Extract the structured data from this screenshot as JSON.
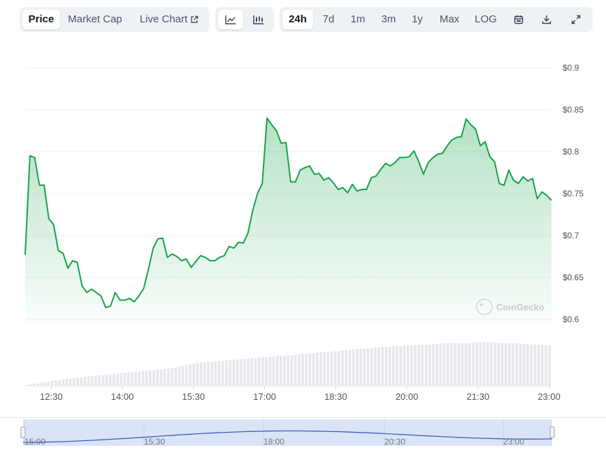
{
  "toolbar": {
    "metric_tabs": [
      {
        "label": "Price",
        "active": true
      },
      {
        "label": "Market Cap",
        "active": false
      },
      {
        "label": "Live Chart",
        "active": false
      }
    ],
    "chart_type_icons": [
      "line-chart-icon",
      "candlestick-chart-icon"
    ],
    "range_tabs": [
      {
        "label": "24h",
        "active": true
      },
      {
        "label": "7d",
        "active": false
      },
      {
        "label": "1m",
        "active": false
      },
      {
        "label": "3m",
        "active": false
      },
      {
        "label": "1y",
        "active": false
      },
      {
        "label": "Max",
        "active": false
      },
      {
        "label": "LOG",
        "active": false
      }
    ],
    "action_icons": [
      "calendar-icon",
      "download-icon",
      "expand-icon"
    ]
  },
  "watermark": {
    "text": "CoinGecko",
    "icon": "coingecko-logo-icon"
  },
  "colors": {
    "line": "#16a34a",
    "fill_top": "#16a34a",
    "volume": "#e5e7eb",
    "grid": "#eef0f3",
    "navigator_line": "#3b5fc4",
    "navigator_fill": "#dbe4f7"
  },
  "chart_data": {
    "type": "area",
    "title": "",
    "xlabel": "",
    "ylabel": "",
    "ylim": [
      0.585,
      0.9
    ],
    "y_ticks": [
      "$0.9",
      "$0.85",
      "$0.8",
      "$0.75",
      "$0.7",
      "$0.65",
      "$0.6"
    ],
    "x_ticks": [
      "12:30",
      "14:00",
      "15:30",
      "17:00",
      "18:30",
      "20:00",
      "21:30",
      "23:00"
    ],
    "grid": true,
    "x_hours": [
      11.95,
      12.05,
      12.15,
      12.25,
      12.35,
      12.45,
      12.55,
      12.65,
      12.75,
      12.85,
      12.95,
      13.05,
      13.15,
      13.25,
      13.35,
      13.45,
      13.55,
      13.65,
      13.75,
      13.85,
      13.95,
      14.05,
      14.15,
      14.25,
      14.35,
      14.45,
      14.55,
      14.65,
      14.75,
      14.85,
      14.95,
      15.05,
      15.15,
      15.25,
      15.35,
      15.45,
      15.55,
      15.65,
      15.75,
      15.85,
      15.95,
      16.05,
      16.15,
      16.25,
      16.35,
      16.45,
      16.55,
      16.65,
      16.75,
      16.85,
      16.95,
      17.05,
      17.15,
      17.25,
      17.35,
      17.45,
      17.55,
      17.65,
      17.75,
      17.85,
      17.95,
      18.05,
      18.15,
      18.25,
      18.35,
      18.45,
      18.55,
      18.65,
      18.75,
      18.85,
      18.95,
      19.05,
      19.15,
      19.25,
      19.35,
      19.45,
      19.55,
      19.65,
      19.75,
      19.85,
      19.95,
      20.05,
      20.15,
      20.25,
      20.35,
      20.45,
      20.55,
      20.65,
      20.75,
      20.85,
      20.95,
      21.05,
      21.15,
      21.25,
      21.35,
      21.45,
      21.55,
      21.65,
      21.75,
      21.85,
      21.95,
      22.05,
      22.15,
      22.25,
      22.35,
      22.45,
      22.55,
      22.65,
      22.75,
      22.85,
      22.95,
      23.05
    ],
    "series": [
      {
        "values": [
          0.677,
          0.795,
          0.793,
          0.76,
          0.76,
          0.72,
          0.713,
          0.682,
          0.679,
          0.661,
          0.67,
          0.668,
          0.64,
          0.632,
          0.636,
          0.632,
          0.628,
          0.614,
          0.616,
          0.632,
          0.623,
          0.623,
          0.625,
          0.621,
          0.628,
          0.637,
          0.66,
          0.685,
          0.696,
          0.697,
          0.674,
          0.678,
          0.675,
          0.67,
          0.672,
          0.662,
          0.669,
          0.676,
          0.674,
          0.67,
          0.67,
          0.674,
          0.676,
          0.687,
          0.685,
          0.692,
          0.691,
          0.703,
          0.73,
          0.75,
          0.762,
          0.84,
          0.832,
          0.825,
          0.81,
          0.811,
          0.764,
          0.764,
          0.778,
          0.781,
          0.783,
          0.773,
          0.774,
          0.766,
          0.769,
          0.763,
          0.755,
          0.757,
          0.751,
          0.761,
          0.753,
          0.755,
          0.755,
          0.769,
          0.771,
          0.779,
          0.786,
          0.783,
          0.787,
          0.793,
          0.793,
          0.794,
          0.801,
          0.788,
          0.773,
          0.787,
          0.793,
          0.797,
          0.798,
          0.807,
          0.814,
          0.817,
          0.818,
          0.839,
          0.832,
          0.827,
          0.807,
          0.812,
          0.794,
          0.788,
          0.762,
          0.76,
          0.778,
          0.766,
          0.762,
          0.77,
          0.765,
          0.768,
          0.744,
          0.752,
          0.748,
          0.742,
          0.746,
          0.747,
          0.753,
          0.774
        ]
      }
    ],
    "volume": [
      1,
      2,
      3,
      4,
      5,
      5,
      6,
      7,
      8,
      8,
      9,
      10,
      10,
      11,
      12,
      12,
      13,
      13,
      14,
      14,
      15,
      15,
      16,
      16,
      17,
      17,
      18,
      18,
      19,
      19,
      20,
      20,
      21,
      21,
      22,
      22,
      23,
      23,
      24,
      24,
      25,
      26,
      27,
      28,
      29,
      30,
      31,
      32,
      33,
      33,
      34,
      34,
      35,
      35,
      35,
      36,
      36,
      37,
      37,
      37,
      38,
      38,
      39,
      39,
      40,
      40,
      40,
      41,
      41,
      42,
      42,
      42,
      43,
      43,
      44,
      44,
      45,
      45,
      46,
      46,
      47,
      47,
      48,
      48,
      48,
      49,
      49,
      50,
      50,
      51,
      51,
      52,
      52,
      52,
      53,
      53,
      54,
      54,
      55,
      55,
      55,
      56,
      56,
      56,
      57,
      57,
      57,
      57,
      58,
      58,
      58,
      58,
      59,
      59,
      59,
      60,
      60,
      60,
      60,
      60,
      60,
      60,
      60,
      61,
      61,
      61,
      61,
      61,
      61,
      61,
      61,
      60,
      60,
      60,
      60,
      60,
      59,
      59,
      59,
      58,
      58,
      58,
      58,
      57,
      57
    ],
    "navigator": {
      "x_ticks": [
        "15:00",
        "15:30",
        "18:00",
        "20:30",
        "23:00"
      ]
    }
  }
}
